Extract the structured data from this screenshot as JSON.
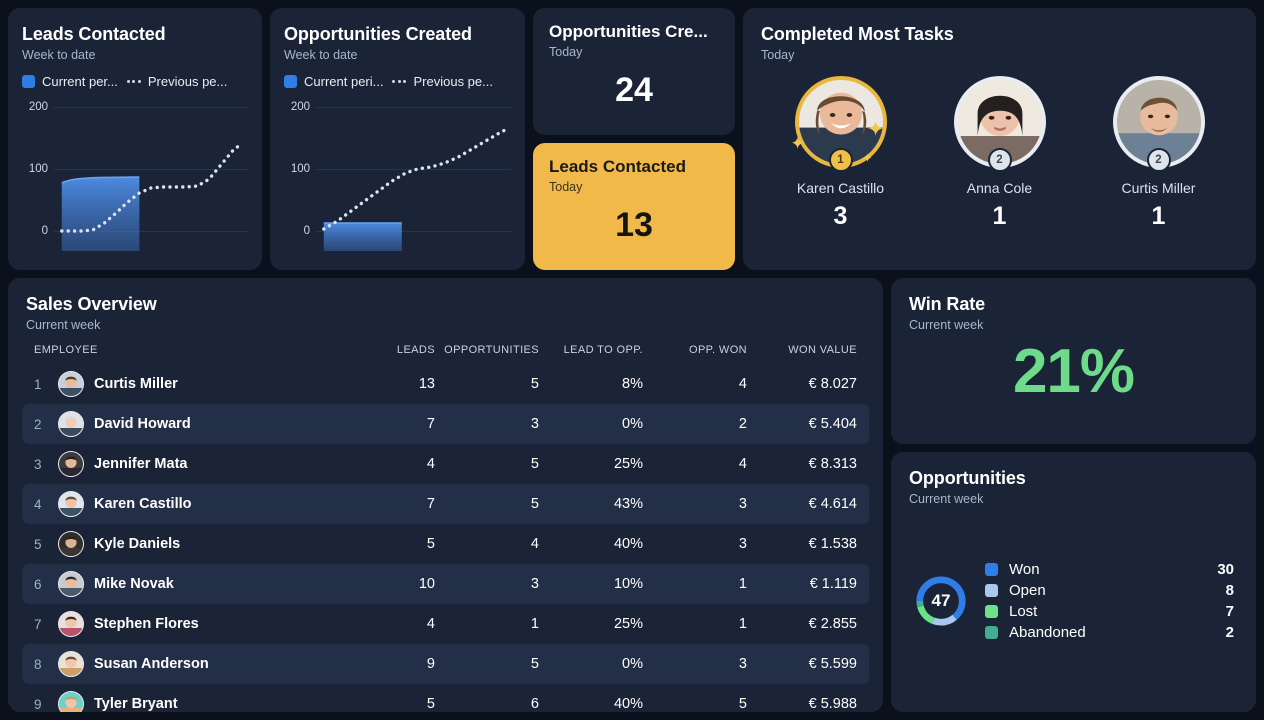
{
  "theme": {
    "bg": "#0b111c",
    "card": "#1b2436",
    "card_alt": "#232f46",
    "accent_blue": "#2f7ee8",
    "accent_yellow": "#f0b949",
    "accent_green": "#6ddb8a",
    "text": "#ffffff",
    "muted": "#a9b6cc"
  },
  "leads_chart": {
    "title": "Leads Contacted",
    "subtitle": "Week to date",
    "legend_current": "Current per...",
    "legend_previous": "Previous pe..."
  },
  "opportunities_chart": {
    "title": "Opportunities Created",
    "subtitle": "Week to date",
    "legend_current": "Current peri...",
    "legend_previous": "Previous pe..."
  },
  "kpi_opportunities": {
    "title": "Opportunities Cre...",
    "subtitle": "Today",
    "value": "24"
  },
  "kpi_leads": {
    "title": "Leads Contacted",
    "subtitle": "Today",
    "value": "13"
  },
  "tasks": {
    "title": "Completed Most Tasks",
    "subtitle": "Today",
    "people": [
      {
        "name": "Karen Castillo",
        "value": "3",
        "rank": "1",
        "gold": true
      },
      {
        "name": "Anna Cole",
        "value": "1",
        "rank": "2",
        "gold": false
      },
      {
        "name": "Curtis Miller",
        "value": "1",
        "rank": "2",
        "gold": false
      }
    ]
  },
  "sales": {
    "title": "Sales Overview",
    "subtitle": "Current week",
    "columns": {
      "employee": "EMPLOYEE",
      "leads": "LEADS",
      "opportunities": "OPPORTUNITIES",
      "lead_to_opp": "LEAD TO OPP.",
      "opp_won": "OPP. WON",
      "won_value": "WON VALUE"
    },
    "rows": [
      {
        "rank": "1",
        "name": "Curtis Miller",
        "leads": "13",
        "opportunities": "5",
        "lead_to_opp": "8%",
        "opp_won": "4",
        "won_value": "€ 8.027"
      },
      {
        "rank": "2",
        "name": "David Howard",
        "leads": "7",
        "opportunities": "3",
        "lead_to_opp": "0%",
        "opp_won": "2",
        "won_value": "€ 5.404"
      },
      {
        "rank": "3",
        "name": "Jennifer Mata",
        "leads": "4",
        "opportunities": "5",
        "lead_to_opp": "25%",
        "opp_won": "4",
        "won_value": "€ 8.313"
      },
      {
        "rank": "4",
        "name": "Karen Castillo",
        "leads": "7",
        "opportunities": "5",
        "lead_to_opp": "43%",
        "opp_won": "3",
        "won_value": "€ 4.614"
      },
      {
        "rank": "5",
        "name": "Kyle Daniels",
        "leads": "5",
        "opportunities": "4",
        "lead_to_opp": "40%",
        "opp_won": "3",
        "won_value": "€ 1.538"
      },
      {
        "rank": "6",
        "name": "Mike Novak",
        "leads": "10",
        "opportunities": "3",
        "lead_to_opp": "10%",
        "opp_won": "1",
        "won_value": "€ 1.119"
      },
      {
        "rank": "7",
        "name": "Stephen Flores",
        "leads": "4",
        "opportunities": "1",
        "lead_to_opp": "25%",
        "opp_won": "1",
        "won_value": "€ 2.855"
      },
      {
        "rank": "8",
        "name": "Susan Anderson",
        "leads": "9",
        "opportunities": "5",
        "lead_to_opp": "0%",
        "opp_won": "3",
        "won_value": "€ 5.599"
      },
      {
        "rank": "9",
        "name": "Tyler Bryant",
        "leads": "5",
        "opportunities": "6",
        "lead_to_opp": "40%",
        "opp_won": "5",
        "won_value": "€ 5.988"
      }
    ]
  },
  "win_rate": {
    "title": "Win Rate",
    "subtitle": "Current week",
    "value": "21%"
  },
  "opportunities_panel": {
    "title": "Opportunities",
    "subtitle": "Current week",
    "total": "47",
    "items": [
      {
        "label": "Won",
        "count": "30",
        "color": "#2f7ee8"
      },
      {
        "label": "Open",
        "count": "8",
        "color": "#a8c8f0"
      },
      {
        "label": "Lost",
        "count": "7",
        "color": "#6ee08a"
      },
      {
        "label": "Abandoned",
        "count": "2",
        "color": "#3fae92"
      }
    ]
  },
  "chart_data": [
    {
      "type": "area",
      "title": "Leads Contacted",
      "subtitle": "Week to date",
      "xlabel": "",
      "ylabel": "",
      "ylim": [
        0,
        220
      ],
      "yticks": [
        0,
        100,
        200
      ],
      "grid": true,
      "legend_position": "top-left",
      "series": [
        {
          "name": "Current per...",
          "style": "area",
          "color": "#2f7ee8",
          "x": [
            0,
            10,
            20,
            30,
            40,
            45
          ],
          "values": [
            78,
            80,
            81,
            82,
            83,
            84
          ]
        },
        {
          "name": "Previous pe...",
          "style": "dotted",
          "color": "#cfd9ea",
          "x": [
            0,
            10,
            20,
            30,
            40,
            50,
            60,
            70,
            80,
            90,
            100
          ],
          "values": [
            2,
            3,
            5,
            20,
            45,
            68,
            72,
            73,
            74,
            100,
            128
          ]
        }
      ]
    },
    {
      "type": "area",
      "title": "Opportunities Created",
      "subtitle": "Week to date",
      "xlabel": "",
      "ylabel": "",
      "ylim": [
        0,
        220
      ],
      "yticks": [
        0,
        100,
        200
      ],
      "grid": true,
      "legend_position": "top-left",
      "series": [
        {
          "name": "Current peri...",
          "style": "area",
          "color": "#2f7ee8",
          "x": [
            0,
            10,
            20,
            30,
            40,
            45
          ],
          "values": [
            12,
            12,
            12,
            12,
            12,
            13
          ]
        },
        {
          "name": "Previous pe...",
          "style": "dotted",
          "color": "#cfd9ea",
          "x": [
            0,
            10,
            20,
            30,
            40,
            50,
            60,
            70,
            80,
            90,
            100
          ],
          "values": [
            5,
            25,
            48,
            70,
            88,
            105,
            112,
            122,
            138,
            152,
            165
          ]
        }
      ]
    },
    {
      "type": "pie",
      "title": "Opportunities",
      "subtitle": "Current week",
      "labels": [
        "Won",
        "Open",
        "Lost",
        "Abandoned"
      ],
      "values": [
        30,
        8,
        7,
        2
      ],
      "colors": [
        "#2f7ee8",
        "#a8c8f0",
        "#6ee08a",
        "#3fae92"
      ],
      "total": 47,
      "legend_position": "right"
    }
  ]
}
